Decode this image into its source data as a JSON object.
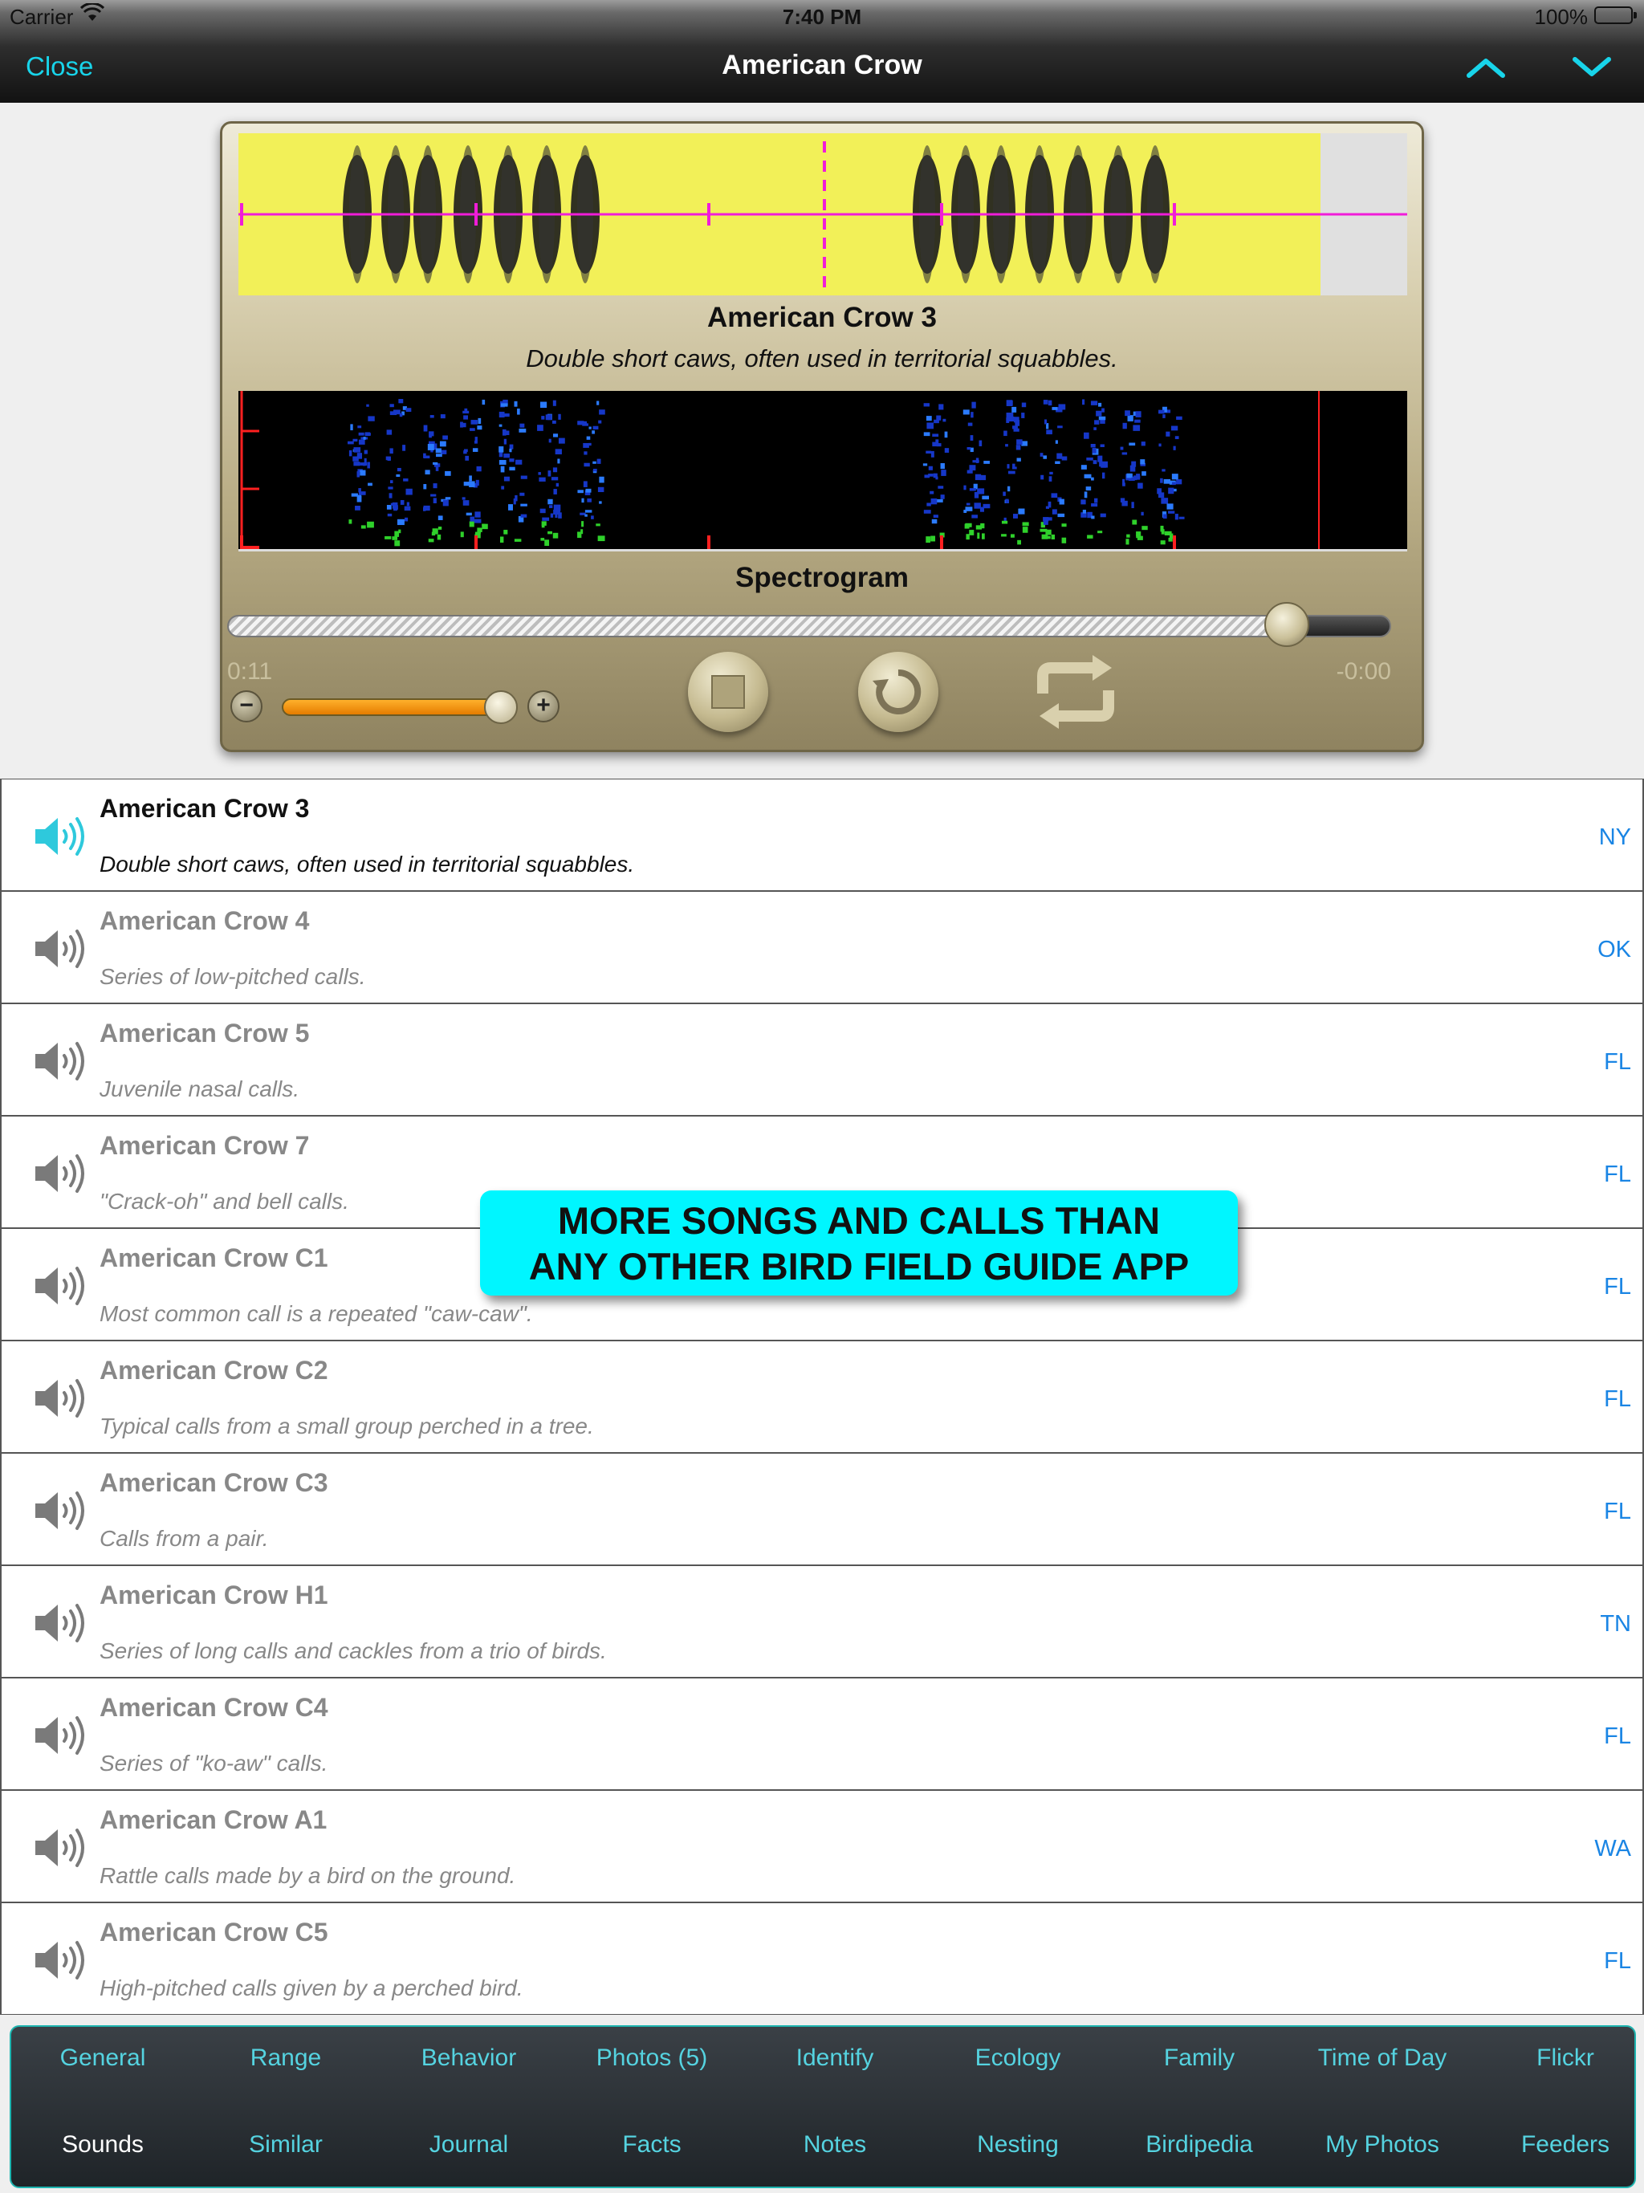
{
  "status_bar": {
    "carrier": "Carrier",
    "time": "7:40 PM",
    "battery": "100%"
  },
  "nav": {
    "close_label": "Close",
    "title": "American Crow",
    "up_icon": "chevron-up-icon",
    "down_icon": "chevron-down-icon",
    "accent": "#18d4ea"
  },
  "player": {
    "recording_title": "American Crow 3",
    "recording_desc": "Double short caws, often used in territorial squabbles.",
    "spectrogram_label": "Spectrogram",
    "elapsed": "0:11",
    "remaining": "-0:00",
    "progress": 0.91,
    "volume": 0.95
  },
  "recordings": [
    {
      "title": "American Crow 3",
      "desc": "Double short caws, often used in territorial squabbles.",
      "state": "NY"
    },
    {
      "title": "American Crow 4",
      "desc": "Series of low-pitched calls.",
      "state": "OK"
    },
    {
      "title": "American Crow 5",
      "desc": "Juvenile nasal calls.",
      "state": "FL"
    },
    {
      "title": "American Crow 7",
      "desc": "\"Crack-oh\" and bell calls.",
      "state": "FL"
    },
    {
      "title": "American Crow C1",
      "desc": "Most common call is a repeated \"caw-caw\".",
      "state": "FL"
    },
    {
      "title": "American Crow C2",
      "desc": "Typical calls from a small group perched in a tree.",
      "state": "FL"
    },
    {
      "title": "American Crow C3",
      "desc": "Calls from a pair.",
      "state": "FL"
    },
    {
      "title": "American Crow H1",
      "desc": "Series of long calls and cackles from a trio of birds.",
      "state": "TN"
    },
    {
      "title": "American Crow C4",
      "desc": "Series of \"ko-aw\" calls.",
      "state": "FL"
    },
    {
      "title": "American Crow A1",
      "desc": "Rattle calls made by a bird on the ground.",
      "state": "WA"
    },
    {
      "title": "American Crow C5",
      "desc": "High-pitched calls given by a perched bird.",
      "state": "FL"
    }
  ],
  "promo": {
    "line1": "MORE SONGS AND CALLS THAN",
    "line2": "ANY OTHER BIRD FIELD GUIDE APP"
  },
  "tabs": {
    "row1": [
      "General",
      "Range",
      "Behavior",
      "Photos (5)",
      "Identify",
      "Ecology",
      "Family",
      "Time of Day",
      "Flickr"
    ],
    "row2": [
      "Sounds",
      "Similar",
      "Journal",
      "Facts",
      "Notes",
      "Nesting",
      "Birdipedia",
      "My Photos",
      "Feeders"
    ],
    "active": "Sounds"
  }
}
